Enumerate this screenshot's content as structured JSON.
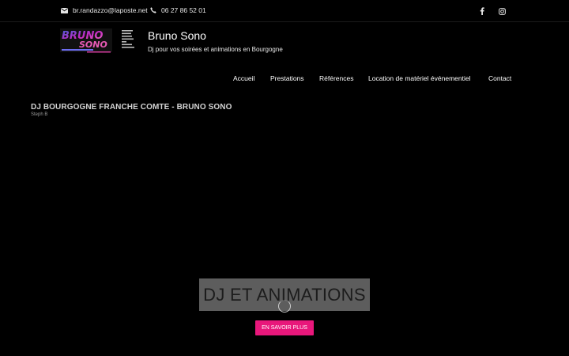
{
  "topbar": {
    "email": "br.randazzo@laposte.net",
    "phone": "06 27 86 52 01",
    "email_icon": "envelope-icon",
    "phone_icon": "phone-icon",
    "social": [
      {
        "icon": "facebook-icon"
      },
      {
        "icon": "instagram-icon"
      }
    ]
  },
  "header": {
    "title": "Bruno Sono",
    "tagline": "Dj pour vos soirées et animations en Bourgogne",
    "logo_icon": "bruno-sono-logo"
  },
  "nav": {
    "items": [
      "Accueil",
      "Prestations",
      "Références",
      "Location de matériel événementiel",
      "Contact"
    ]
  },
  "content": {
    "heading": "DJ BOURGOGNE FRANCHE COMTE - BRUNO SONO",
    "author": "Steph B"
  },
  "hero": {
    "title": "DJ ET ANIMATIONS",
    "cta_label": "EN SAVOIR PLUS"
  },
  "colors": {
    "background": "#000000",
    "accent": "#e8177b",
    "hero_box": "#969696"
  }
}
